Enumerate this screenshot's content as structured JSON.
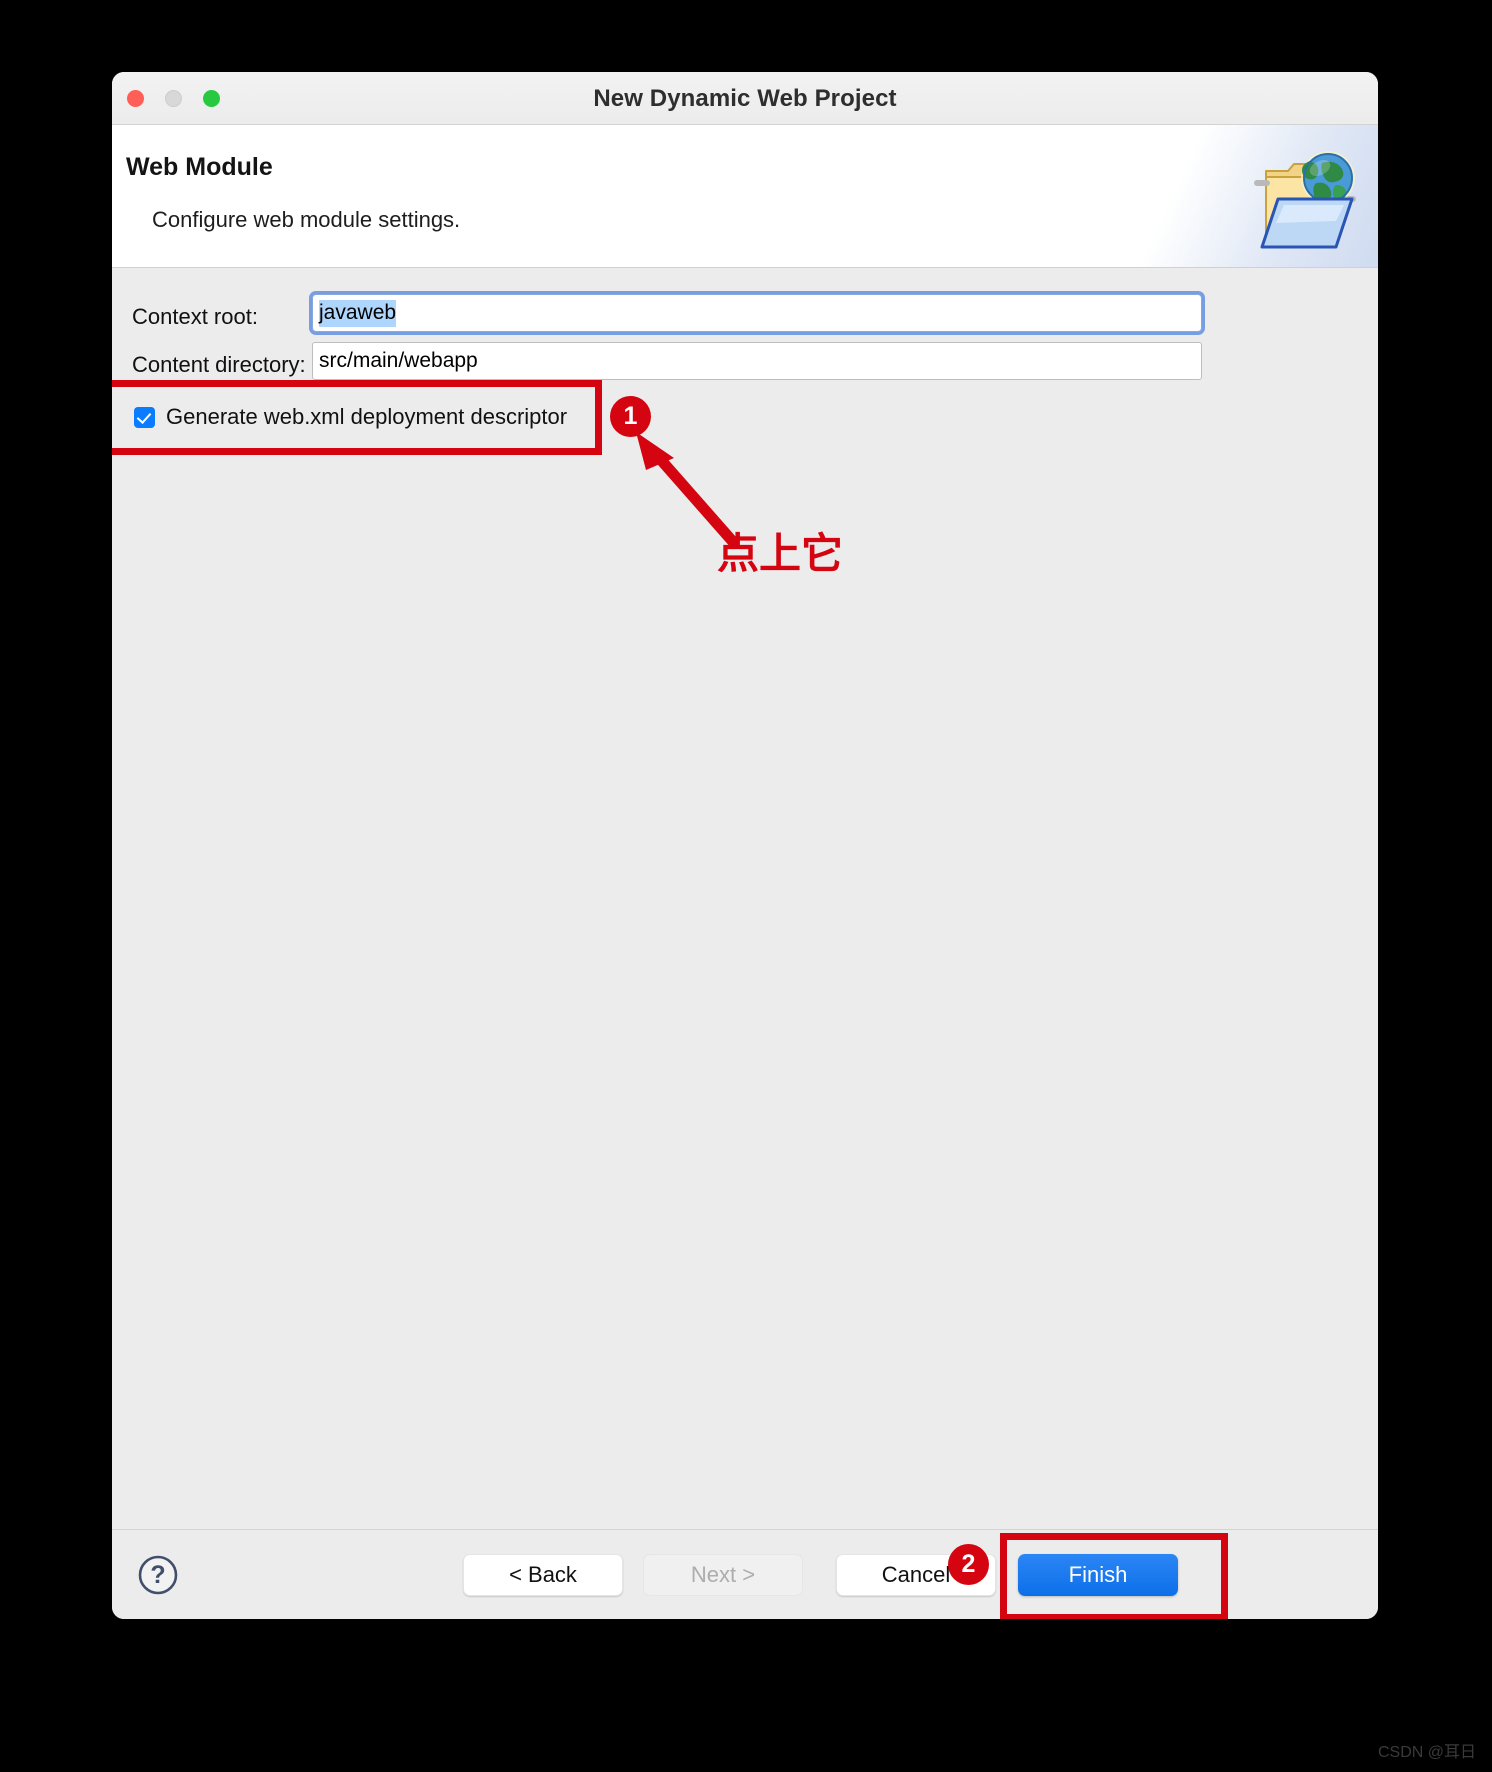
{
  "window": {
    "title": "New Dynamic Web Project",
    "traffic_lights": [
      {
        "name": "close",
        "color": "#ff5f57"
      },
      {
        "name": "minimize",
        "color": "#d8d8d8"
      },
      {
        "name": "maximize",
        "color": "#28c840"
      }
    ]
  },
  "header": {
    "title": "Web Module",
    "subtitle": "Configure web module settings.",
    "icon": "web-folder-globe-icon"
  },
  "form": {
    "context_root": {
      "label": "Context root:",
      "value": "javaweb",
      "selected": true
    },
    "content_directory": {
      "label": "Content directory:",
      "value": "src/main/webapp"
    },
    "generate_webxml": {
      "label": "Generate web.xml deployment descriptor",
      "checked": true
    }
  },
  "annotations": {
    "badge_1": "1",
    "badge_2": "2",
    "note_text": "点上它",
    "color": "#d40511"
  },
  "footer": {
    "help_icon": "question-mark-icon",
    "buttons": [
      {
        "name": "back",
        "label": "< Back",
        "enabled": true
      },
      {
        "name": "next",
        "label": "Next >",
        "enabled": false
      },
      {
        "name": "cancel",
        "label": "Cancel",
        "enabled": true
      },
      {
        "name": "finish",
        "label": "Finish",
        "enabled": true,
        "primary": true
      }
    ]
  },
  "watermark": "CSDN @耳日"
}
